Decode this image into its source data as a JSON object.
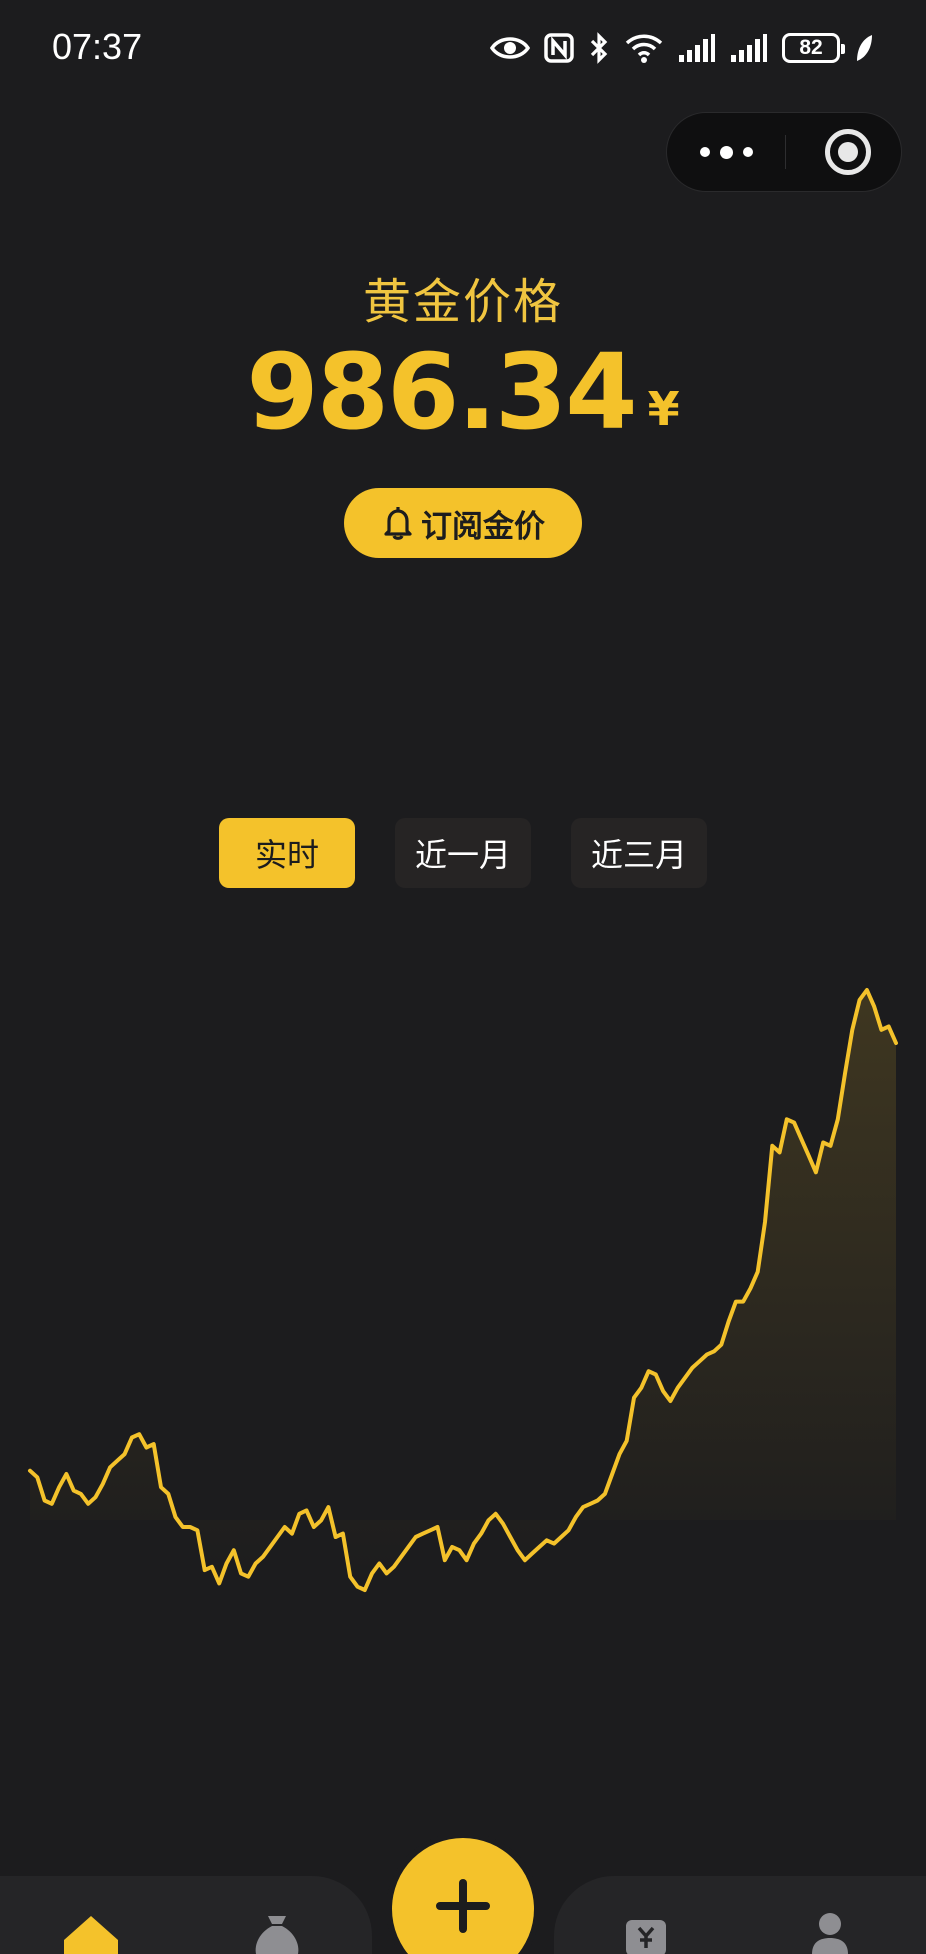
{
  "status_bar": {
    "time": "07:37",
    "battery_level": "82",
    "icons": [
      "eye-icon",
      "nfc-icon",
      "bluetooth-icon",
      "wifi-icon",
      "signal-icon",
      "signal-icon",
      "battery-icon",
      "leaf-icon"
    ]
  },
  "capsule": {
    "icons": [
      "more-icon",
      "close-mini-program-icon"
    ]
  },
  "header": {
    "title": "黄金价格",
    "price": "986.34",
    "unit": "¥"
  },
  "subscribe": {
    "label": "订阅金价",
    "icon": "bell-icon"
  },
  "range_tabs": [
    {
      "label": "实时",
      "active": true
    },
    {
      "label": "近一月",
      "active": false
    },
    {
      "label": "近三月",
      "active": false
    }
  ],
  "colors": {
    "accent": "#f4c22b",
    "background": "#1c1c1e",
    "tab_inactive": "#262424",
    "nav_panel": "#252527"
  },
  "chart_data": {
    "type": "area",
    "x": [
      1,
      2,
      3,
      4,
      5,
      6,
      7,
      8,
      9,
      10,
      11,
      12,
      13,
      14,
      15,
      16,
      17,
      18,
      19,
      20,
      21,
      22,
      23,
      24,
      25,
      26,
      27,
      28,
      29,
      30,
      31,
      32,
      33,
      34,
      35,
      36,
      37,
      38,
      39,
      40,
      41,
      42,
      43,
      44,
      45,
      46,
      47,
      48,
      49,
      50,
      51,
      52,
      53,
      54,
      55,
      56,
      57,
      58,
      59,
      60,
      61,
      62,
      63,
      64,
      65,
      66,
      67,
      68,
      69,
      70,
      71,
      72,
      73,
      74,
      75,
      76,
      77,
      78,
      79,
      80,
      81,
      82,
      83,
      84,
      85,
      86,
      87,
      88,
      89,
      90,
      91,
      92,
      93,
      94,
      95,
      96,
      97,
      98,
      99,
      100,
      101,
      102,
      103,
      104,
      105,
      106,
      107,
      108,
      109,
      110,
      111,
      112,
      113,
      114,
      115,
      116,
      117,
      118,
      119,
      120
    ],
    "values": [
      50,
      46,
      32,
      30,
      40,
      48,
      38,
      36,
      30,
      34,
      42,
      52,
      56,
      60,
      70,
      72,
      64,
      66,
      40,
      36,
      22,
      16,
      16,
      14,
      -10,
      -8,
      -18,
      -6,
      2,
      -12,
      -14,
      -6,
      -2,
      4,
      10,
      16,
      12,
      24,
      26,
      16,
      20,
      28,
      10,
      12,
      -14,
      -20,
      -22,
      -12,
      -6,
      -12,
      -8,
      -2,
      4,
      10,
      12,
      14,
      16,
      -4,
      4,
      2,
      -4,
      6,
      12,
      20,
      24,
      18,
      10,
      2,
      -4,
      0,
      4,
      8,
      6,
      10,
      14,
      22,
      28,
      30,
      32,
      36,
      48,
      60,
      68,
      94,
      100,
      110,
      108,
      98,
      92,
      100,
      106,
      112,
      116,
      120,
      122,
      126,
      140,
      152,
      152,
      160,
      170,
      200,
      246,
      242,
      262,
      260,
      250,
      240,
      230,
      248,
      246,
      262,
      290,
      316,
      334,
      340,
      330,
      316,
      318,
      308,
      298,
      278
    ]
  },
  "bottom_nav": {
    "items": [
      "home-icon",
      "money-bag-icon",
      "add-icon",
      "ledger-icon",
      "profile-icon"
    ]
  }
}
